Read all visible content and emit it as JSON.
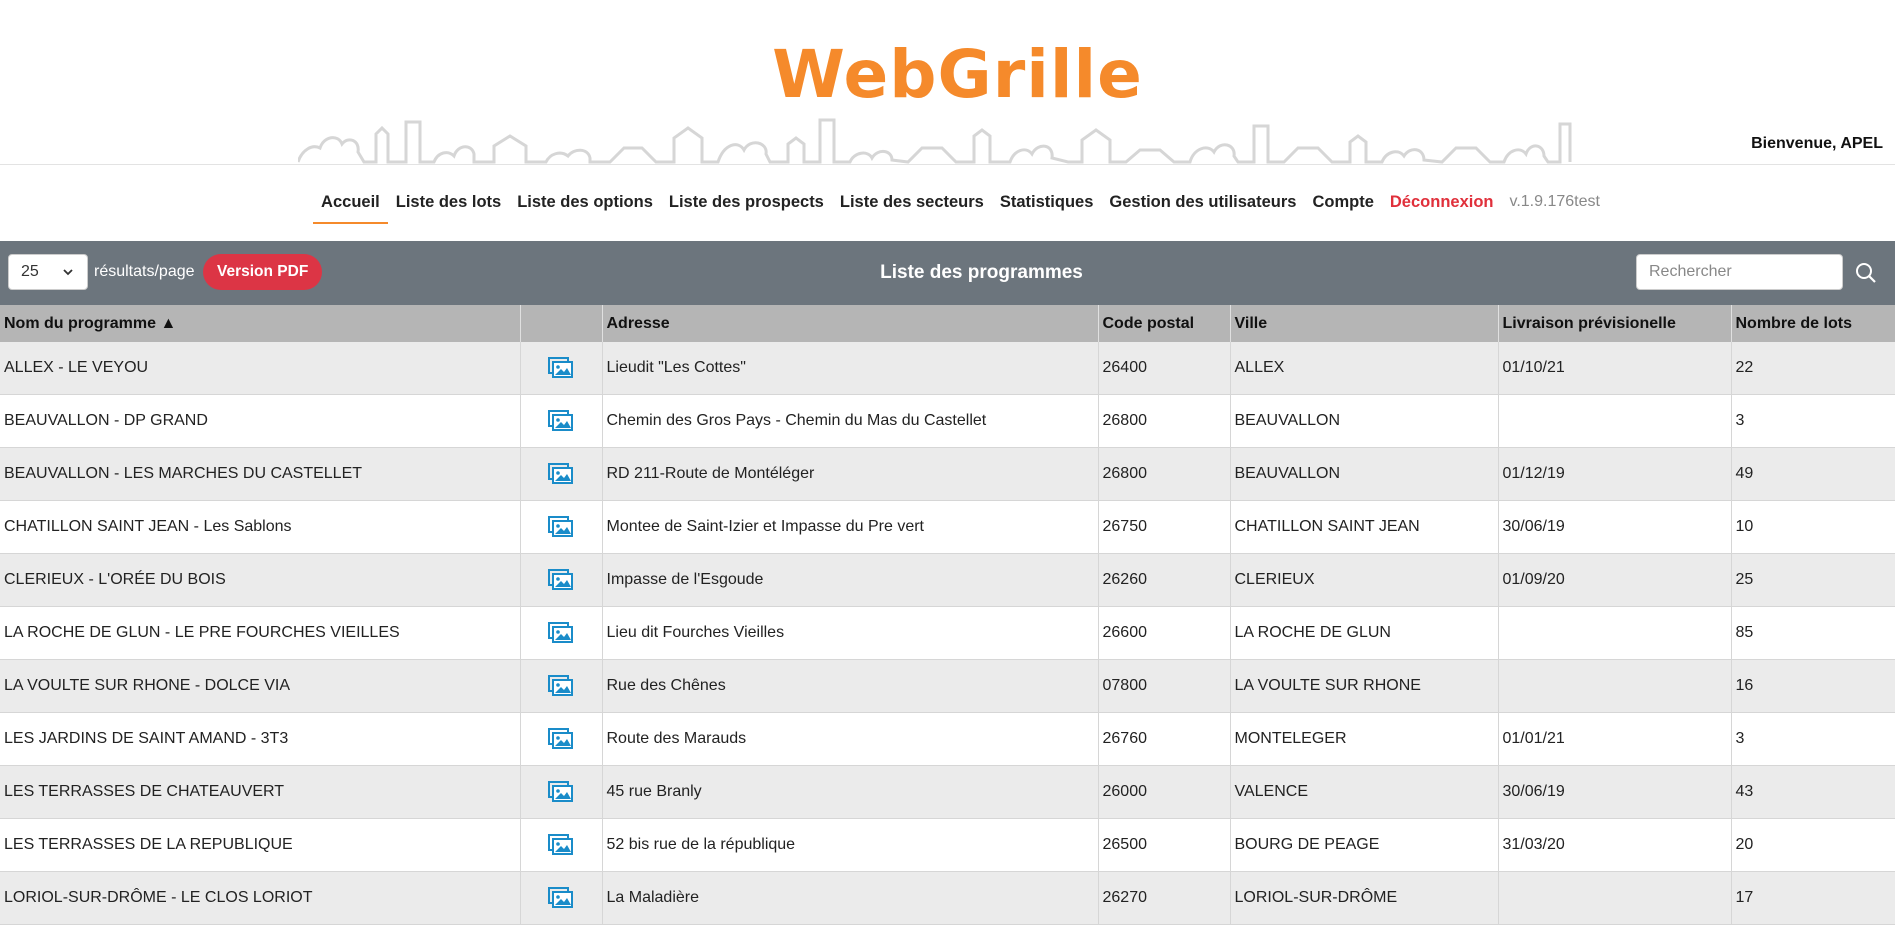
{
  "app": {
    "logo": "WebGrille",
    "welcome": "Bienvenue, APEL"
  },
  "nav": {
    "items": [
      "Accueil",
      "Liste des lots",
      "Liste des options",
      "Liste des prospects",
      "Liste des secteurs",
      "Statistiques",
      "Gestion des utilisateurs",
      "Compte"
    ],
    "logout": "Déconnexion",
    "version": "v.1.9.176test",
    "active": "Accueil"
  },
  "toolbar": {
    "page_size": "25",
    "per_page_label": "résultats/page",
    "pdf_label": "Version PDF",
    "title": "Liste des programmes",
    "search_placeholder": "Rechercher"
  },
  "table": {
    "headers": [
      "Nom du programme ▲",
      "",
      "Adresse",
      "Code postal",
      "Ville",
      "Livraison prévisionelle",
      "Nombre de lots"
    ],
    "rows": [
      [
        "ALLEX - LE VEYOU",
        "Lieudit \"Les Cottes\"",
        "26400",
        "ALLEX",
        "01/10/21",
        "22"
      ],
      [
        "BEAUVALLON - DP GRAND",
        "Chemin des Gros Pays - Chemin du Mas du Castellet",
        "26800",
        "BEAUVALLON",
        "",
        "3"
      ],
      [
        "BEAUVALLON - LES MARCHES DU CASTELLET",
        "RD 211-Route de Montéléger",
        "26800",
        "BEAUVALLON",
        "01/12/19",
        "49"
      ],
      [
        "CHATILLON SAINT JEAN - Les Sablons",
        "Montee de Saint-Izier et Impasse du Pre vert",
        "26750",
        "CHATILLON SAINT JEAN",
        "30/06/19",
        "10"
      ],
      [
        "CLERIEUX - L'ORÉE DU BOIS",
        "Impasse de l'Esgoude",
        "26260",
        "CLERIEUX",
        "01/09/20",
        "25"
      ],
      [
        "LA ROCHE DE GLUN - LE PRE FOURCHES VIEILLES",
        "Lieu dit Fourches Vieilles",
        "26600",
        "LA ROCHE DE GLUN",
        "",
        "85"
      ],
      [
        "LA VOULTE SUR RHONE - DOLCE VIA",
        "Rue des Chênes",
        "07800",
        "LA VOULTE SUR RHONE",
        "",
        "16"
      ],
      [
        "LES JARDINS DE SAINT AMAND - 3T3",
        "Route des Marauds",
        "26760",
        "MONTELEGER",
        "01/01/21",
        "3"
      ],
      [
        "LES TERRASSES DE CHATEAUVERT",
        "45 rue Branly",
        "26000",
        "VALENCE",
        "30/06/19",
        "43"
      ],
      [
        "LES TERRASSES DE LA REPUBLIQUE",
        "52 bis rue de la république",
        "26500",
        "BOURG DE PEAGE",
        "31/03/20",
        "20"
      ],
      [
        "LORIOL-SUR-DRÔME - LE CLOS LORIOT",
        "La Maladière",
        "26270",
        "LORIOL-SUR-DRÔME",
        "",
        "17"
      ]
    ]
  },
  "icons": {
    "row_image": "image-gallery-icon",
    "search": "search-icon",
    "select_arrow": "chevron-down-icon"
  },
  "colors": {
    "brand": "#f58a2b",
    "toolbar": "#6c757d",
    "pdf": "#dc3545",
    "logout": "#e0303b",
    "icon_blue": "#1a8cc9"
  }
}
